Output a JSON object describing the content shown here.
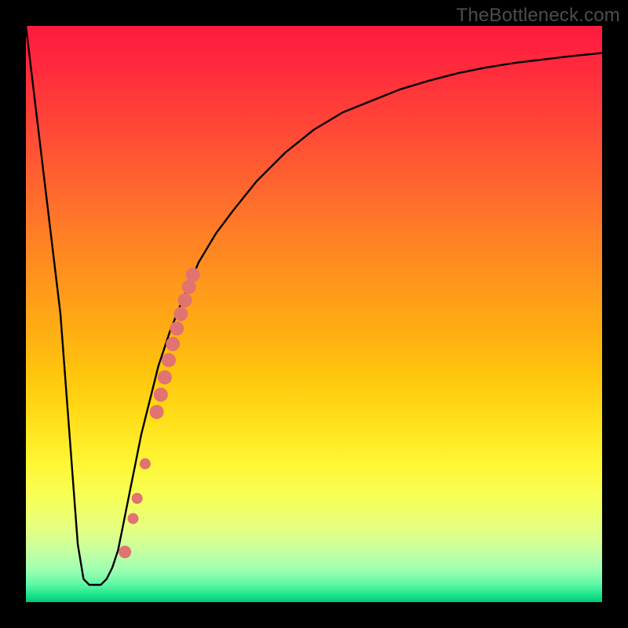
{
  "watermark": "TheBottleneck.com",
  "chart_data": {
    "type": "line",
    "title": "",
    "xlabel": "",
    "ylabel": "",
    "xlim": [
      0,
      100
    ],
    "ylim": [
      0,
      100
    ],
    "grid": false,
    "series": [
      {
        "name": "curve",
        "x": [
          0,
          6,
          9,
          10,
          11,
          12,
          13,
          14,
          15,
          16,
          17,
          18,
          19,
          20,
          21,
          22,
          23,
          24,
          25,
          27,
          30,
          33,
          36,
          40,
          45,
          50,
          55,
          60,
          65,
          70,
          75,
          80,
          85,
          90,
          95,
          100
        ],
        "values": [
          100,
          50,
          10,
          4,
          3,
          3,
          3,
          4,
          6,
          9,
          14,
          19,
          24,
          29,
          33,
          37,
          41,
          44,
          47,
          52,
          59,
          64,
          68,
          73,
          78,
          82,
          85,
          87,
          89,
          90.5,
          91.8,
          92.8,
          93.6,
          94.2,
          94.8,
          95.3
        ]
      }
    ],
    "highlight_points": [
      {
        "x_pct": 17.2,
        "y_pct": 91.3,
        "r": 8
      },
      {
        "x_pct": 18.6,
        "y_pct": 85.5,
        "r": 7
      },
      {
        "x_pct": 19.3,
        "y_pct": 82.0,
        "r": 7
      },
      {
        "x_pct": 20.7,
        "y_pct": 76.0,
        "r": 7
      },
      {
        "x_pct": 22.7,
        "y_pct": 67.0,
        "r": 9
      },
      {
        "x_pct": 23.4,
        "y_pct": 64.0,
        "r": 9
      },
      {
        "x_pct": 24.1,
        "y_pct": 61.0,
        "r": 9
      },
      {
        "x_pct": 24.8,
        "y_pct": 58.0,
        "r": 9
      },
      {
        "x_pct": 25.5,
        "y_pct": 55.2,
        "r": 9
      },
      {
        "x_pct": 26.2,
        "y_pct": 52.5,
        "r": 9
      },
      {
        "x_pct": 26.9,
        "y_pct": 50.0,
        "r": 9
      },
      {
        "x_pct": 27.6,
        "y_pct": 47.6,
        "r": 9
      },
      {
        "x_pct": 28.3,
        "y_pct": 45.3,
        "r": 9
      },
      {
        "x_pct": 29.0,
        "y_pct": 43.2,
        "r": 9
      }
    ],
    "highlight_color": "#e17370",
    "curve_color": "#000000",
    "gradient_stops": [
      {
        "pos": 0.0,
        "color": "#ff1a3f"
      },
      {
        "pos": 0.5,
        "color": "#ffb010"
      },
      {
        "pos": 0.8,
        "color": "#fff040"
      },
      {
        "pos": 0.95,
        "color": "#a0ffb0"
      },
      {
        "pos": 1.0,
        "color": "#00c878"
      }
    ]
  }
}
